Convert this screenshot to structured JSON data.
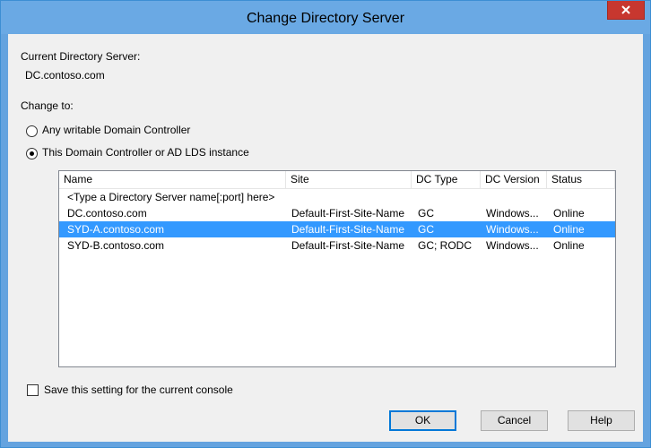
{
  "window": {
    "title": "Change Directory Server",
    "close_glyph": "x"
  },
  "current": {
    "label": "Current Directory Server:",
    "value": "DC.contoso.com"
  },
  "change": {
    "label": "Change to:",
    "options": [
      {
        "label": "Any writable Domain Controller",
        "selected": false
      },
      {
        "label": "This Domain Controller or AD LDS instance",
        "selected": true
      }
    ]
  },
  "list": {
    "columns": [
      "Name",
      "Site",
      "DC Type",
      "DC Version",
      "Status"
    ],
    "placeholder_row": "<Type a Directory Server name[:port] here>",
    "rows": [
      {
        "name": "DC.contoso.com",
        "site": "Default-First-Site-Name",
        "type": "GC",
        "version": "Windows...",
        "status": "Online",
        "selected": false
      },
      {
        "name": "SYD-A.contoso.com",
        "site": "Default-First-Site-Name",
        "type": "GC",
        "version": "Windows...",
        "status": "Online",
        "selected": true
      },
      {
        "name": "SYD-B.contoso.com",
        "site": "Default-First-Site-Name",
        "type": "GC; RODC",
        "version": "Windows...",
        "status": "Online",
        "selected": false
      }
    ]
  },
  "save_setting": {
    "label": "Save this setting for the current console",
    "checked": false
  },
  "buttons": {
    "ok": "OK",
    "cancel": "Cancel",
    "help": "Help"
  },
  "colors": {
    "titlebar": "#6aa9e4",
    "close": "#c7372f",
    "selection": "#3399ff"
  }
}
